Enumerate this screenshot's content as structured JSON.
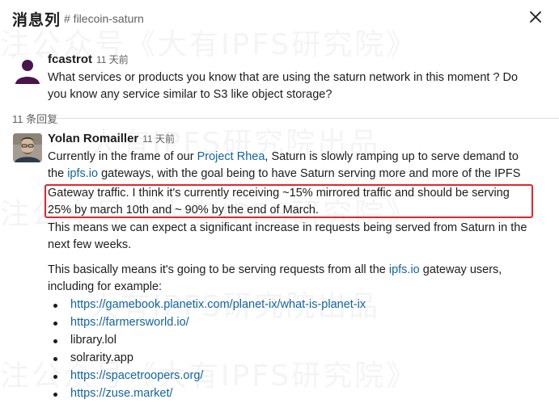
{
  "header": {
    "title": "消息列",
    "channel": "# filecoin-saturn"
  },
  "watermark": {
    "line1": "注公众号《大有IPFS研究院》",
    "line2": "大有IPFS研究院出品"
  },
  "messages": [
    {
      "author": "fcastrot",
      "time": "11 天前",
      "lines": [
        "What services or products you know that are using the saturn network in this moment ? Do",
        "you know any service similar to S3 like object storage?"
      ]
    },
    {
      "author": "Yolan Romailler",
      "time": "11 天前",
      "p1": {
        "l1a": "Currently in the frame of our ",
        "l1link": "Project Rhea",
        "l1b": ", Saturn is slowly ramping up to serve demand to",
        "l2a": "the ",
        "l2link": "ipfs.io",
        "l2b": " gateways, with the goal being to have Saturn serving more and more of the IPFS",
        "l3": "Gateway traffic. I think it's currently receiving ~15% mirrored traffic and should be serving",
        "l4": "25% by march 10th and ~ 90% by the end of March.",
        "l5": "This means we can expect a significant increase in requests being served from Saturn in the",
        "l6": "next few weeks."
      },
      "p2": {
        "l1a": "This basically means it's going to be serving requests from all the ",
        "l1link": "ipfs.io",
        "l1b": " gateway users,",
        "l2": "including for example:"
      },
      "list": [
        {
          "text": "https://gamebook.planetix.com/planet-ix/what-is-planet-ix",
          "link": true
        },
        {
          "text": "https://farmersworld.io/",
          "link": true
        },
        {
          "text": "library.lol",
          "link": false
        },
        {
          "text": "solrarity.app",
          "link": false
        },
        {
          "text": "https://spacetroopers.org/",
          "link": true
        },
        {
          "text": "https://zuse.market/",
          "link": true
        }
      ]
    }
  ],
  "replies_count": "11 条回复",
  "colors": {
    "link": "#1264a3",
    "highlight": "#e0262d",
    "avatar_fcastrot": "#4a154b"
  },
  "icons": {
    "close": "close-icon"
  }
}
